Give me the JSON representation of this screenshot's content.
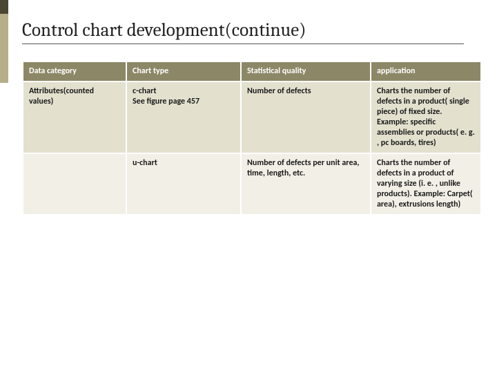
{
  "title": "Control chart development(continue)",
  "table": {
    "headers": [
      "Data category",
      "Chart type",
      "Statistical quality",
      "application"
    ],
    "rows": [
      {
        "data_category": "Attributes(counted values)",
        "chart_type": "c-chart\nSee figure page 457",
        "statistical_quality": "Number of defects",
        "application": "Charts the number of defects in a product( single piece) of fixed size. Example: specific assemblies or products( e. g. , pc boards, tires)"
      },
      {
        "data_category": "",
        "chart_type": "u-chart",
        "statistical_quality": "Number of defects per unit area, time, length, etc.",
        "application": "Charts the number of defects in a product of varying size (i. e. , unlike products). Example: Carpet( area), extrusions length)"
      }
    ]
  }
}
